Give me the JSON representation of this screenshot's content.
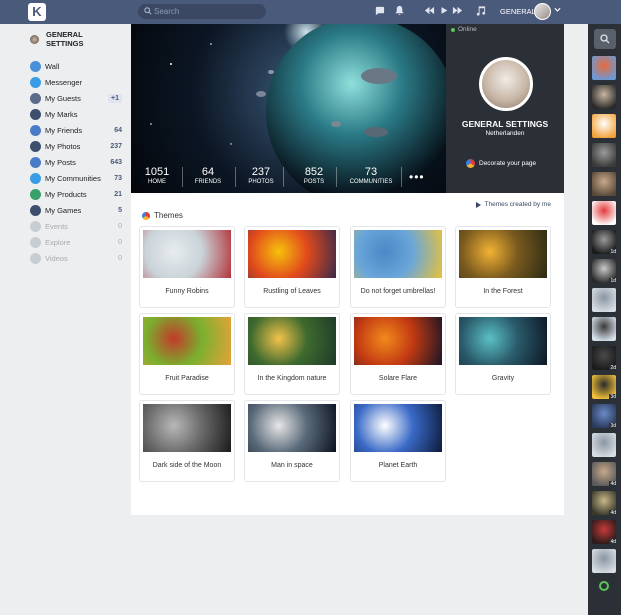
{
  "topbar": {
    "logo_letter": "K",
    "search_placeholder": "Search",
    "user_name": "GENERAL"
  },
  "sidebar": {
    "header": "GENERAL SETTINGS",
    "items": [
      {
        "label": "Wall",
        "count": "",
        "icon": "wall-icon",
        "color": "#4a90d9"
      },
      {
        "label": "Messenger",
        "count": "",
        "icon": "messenger-icon",
        "color": "#3a9ce6"
      },
      {
        "label": "My Guests",
        "count": "+1",
        "icon": "guests-icon",
        "color": "#5b6b88",
        "pill": true
      },
      {
        "label": "My Marks",
        "count": "",
        "icon": "marks-icon",
        "color": "#3d4f6e"
      },
      {
        "label": "My Friends",
        "count": "64",
        "icon": "friends-icon",
        "color": "#4a7bc7"
      },
      {
        "label": "My Photos",
        "count": "237",
        "icon": "photos-icon",
        "color": "#3d4f6e"
      },
      {
        "label": "My Posts",
        "count": "643",
        "icon": "posts-icon",
        "color": "#4a7bc7"
      },
      {
        "label": "My Communities",
        "count": "73",
        "icon": "communities-icon",
        "color": "#3a9ce6"
      },
      {
        "label": "My Products",
        "count": "21",
        "icon": "products-icon",
        "color": "#3aa06a"
      },
      {
        "label": "My Games",
        "count": "5",
        "icon": "games-icon",
        "color": "#3d4f6e"
      },
      {
        "label": "Events",
        "count": "0",
        "icon": "events-icon",
        "color": "#c8ccd3",
        "dim": true
      },
      {
        "label": "Explore",
        "count": "0",
        "icon": "explore-icon",
        "color": "#c8ccd3",
        "dim": true
      },
      {
        "label": "Videos",
        "count": "0",
        "icon": "videos-icon",
        "color": "#c8ccd3",
        "dim": true
      }
    ]
  },
  "cover": {
    "stats": [
      {
        "num": "1051",
        "label": "HOME"
      },
      {
        "num": "64",
        "label": "FRIENDS"
      },
      {
        "num": "237",
        "label": "PHOTOS"
      },
      {
        "num": "852",
        "label": "POSTS"
      },
      {
        "num": "73",
        "label": "COMMUNITIES"
      }
    ],
    "more": "•••"
  },
  "profile": {
    "status": "Online",
    "name": "GENERAL SETTINGS",
    "country": "Netherlanden",
    "decorate": "Decorate your page"
  },
  "themes": {
    "title": "Themes",
    "created_link": "Themes created by me",
    "cards": [
      {
        "name": "Funny Robins",
        "palette": [
          "#e8ecef",
          "#c9d3d8",
          "#b2343a"
        ]
      },
      {
        "name": "Rustling of Leaves",
        "palette": [
          "#f5c20c",
          "#e24a1c",
          "#3b2a4a"
        ]
      },
      {
        "name": "Do not forget umbrellas!",
        "palette": [
          "#4a88c7",
          "#6aa6d9",
          "#e8c23a"
        ]
      },
      {
        "name": "In the Forest",
        "palette": [
          "#f2b234",
          "#7a5a1e",
          "#2b2a14"
        ]
      },
      {
        "name": "Fruit Paradise",
        "palette": [
          "#c23a2a",
          "#7ab02e",
          "#e6a23a"
        ]
      },
      {
        "name": "In the Kingdom nature",
        "palette": [
          "#f1c24a",
          "#3e6a2e",
          "#1e3a2a"
        ]
      },
      {
        "name": "Solare Flare",
        "palette": [
          "#f28a1c",
          "#c23a12",
          "#1a1426"
        ]
      },
      {
        "name": "Gravity",
        "palette": [
          "#5ac0c4",
          "#2a5a6a",
          "#0c1624"
        ]
      },
      {
        "name": "Dark side of the Moon",
        "palette": [
          "#b8b8b8",
          "#6a6a6a",
          "#1a1a1a"
        ]
      },
      {
        "name": "Man in space",
        "palette": [
          "#e6e6e6",
          "#5a6a7a",
          "#0c1220"
        ]
      },
      {
        "name": "Planet Earth",
        "palette": [
          "#ffffff",
          "#3a6ac7",
          "#0c1a3a"
        ]
      }
    ]
  },
  "rail": {
    "avatars": [
      {
        "palette": [
          "#6a9ad6",
          "#e86a3a"
        ],
        "ind": ""
      },
      {
        "palette": [
          "#2a2a2a",
          "#c8b6a0"
        ],
        "ind": ""
      },
      {
        "palette": [
          "#f2a23a",
          "#ffffff"
        ],
        "ind": ""
      },
      {
        "palette": [
          "#3a3a3a",
          "#9a9a9a"
        ],
        "ind": ""
      },
      {
        "palette": [
          "#5a4a3a",
          "#c8a88a"
        ],
        "ind": ""
      },
      {
        "palette": [
          "#ffffff",
          "#e23a3a"
        ],
        "ind": ""
      },
      {
        "palette": [
          "#1a1a1a",
          "#9a9a9a"
        ],
        "ind": "1d"
      },
      {
        "palette": [
          "#2a2a2a",
          "#c8c8c8"
        ],
        "ind": "1d"
      },
      {
        "palette": [
          "#d8dde3",
          "#8a96a3"
        ],
        "ind": ""
      },
      {
        "palette": [
          "#d6e0ea",
          "#3a3a3a"
        ],
        "ind": ""
      },
      {
        "palette": [
          "#1a1a1a",
          "#4a4a4a"
        ],
        "ind": "2d"
      },
      {
        "palette": [
          "#f2c23a",
          "#2a2a2a"
        ],
        "ind": "3d"
      },
      {
        "palette": [
          "#2a3a5a",
          "#6a8ac7"
        ],
        "ind": "3d"
      },
      {
        "palette": [
          "#d8dde3",
          "#8a96a3"
        ],
        "ind": ""
      },
      {
        "palette": [
          "#5a5a5a",
          "#c8a88a"
        ],
        "ind": "4d"
      },
      {
        "palette": [
          "#3a3a2a",
          "#c8b68a"
        ],
        "ind": "4d"
      },
      {
        "palette": [
          "#2a1a1a",
          "#c83a3a"
        ],
        "ind": "4d"
      },
      {
        "palette": [
          "#d8dde3",
          "#8a96a3"
        ],
        "ind": ""
      }
    ]
  },
  "colors": {
    "topbar": "#4a5a7a",
    "accent": "#4a5a7a",
    "rail": "#2b3037",
    "online": "#5cc45a"
  }
}
